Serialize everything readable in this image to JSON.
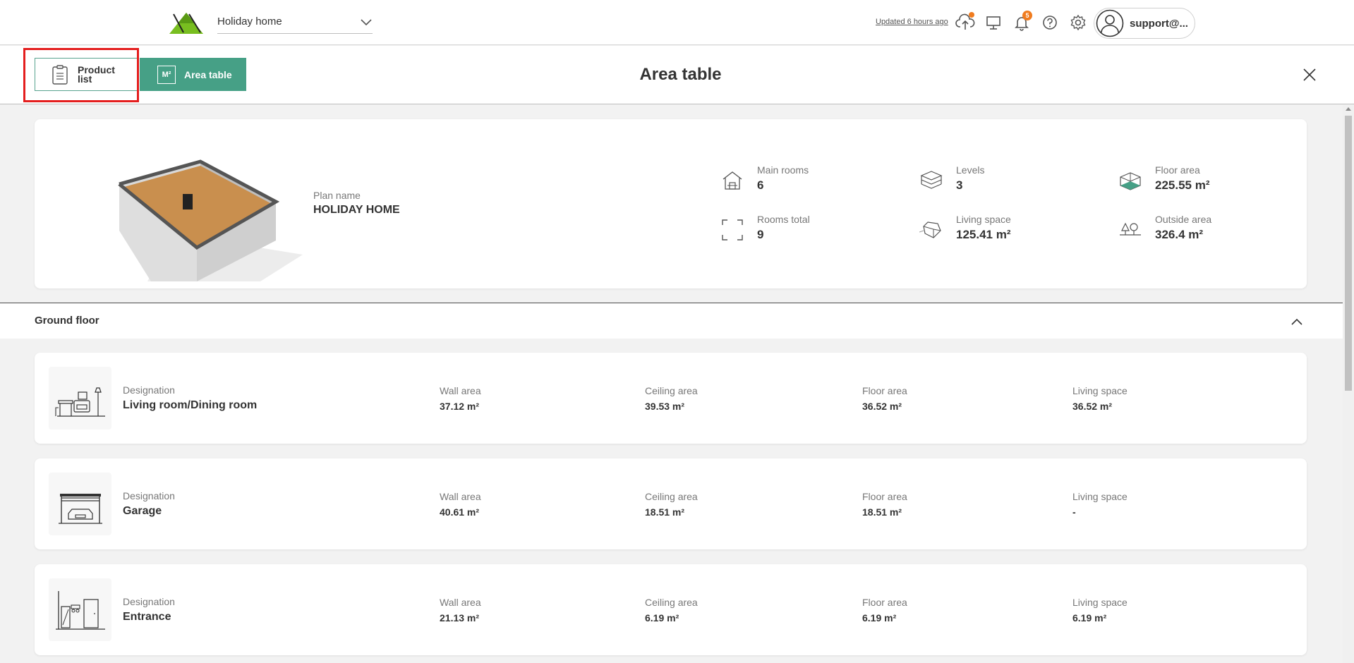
{
  "header": {
    "project_name": "Holiday home",
    "updated_text": "Updated 6 hours ago",
    "notification_count": "5",
    "user_name": "support@...",
    "colors": {
      "accent": "#46a086",
      "badge": "#f07c1f",
      "logo_green": "#78be20"
    }
  },
  "icons": {
    "cloud": "cloud-upload-icon",
    "presentation": "presentation-icon",
    "bell": "bell-icon",
    "help": "help-icon",
    "settings": "gear-icon",
    "user": "user-avatar-icon"
  },
  "tabs": {
    "product_list": "Product list",
    "area_table_icon": "M²",
    "area_table": "Area table"
  },
  "page": {
    "title": "Area table"
  },
  "summary": {
    "plan_name_label": "Plan name",
    "plan_name": "HOLIDAY HOME",
    "stats": {
      "main_rooms": {
        "label": "Main rooms",
        "value": "6"
      },
      "rooms_total": {
        "label": "Rooms total",
        "value": "9"
      },
      "levels": {
        "label": "Levels",
        "value": "3"
      },
      "living_space": {
        "label": "Living space",
        "value": "125.41 m²"
      },
      "floor_area": {
        "label": "Floor area",
        "value": "225.55 m²"
      },
      "outside_area": {
        "label": "Outside area",
        "value": "326.4 m²"
      }
    }
  },
  "section": {
    "title": "Ground floor"
  },
  "room_headers": {
    "designation": "Designation",
    "wall_area": "Wall area",
    "ceiling_area": "Ceiling area",
    "floor_area": "Floor area",
    "living_space": "Living space"
  },
  "rooms": [
    {
      "name": "Living room/Dining room",
      "wall_area": "37.12 m²",
      "ceiling_area": "39.53 m²",
      "floor_area": "36.52 m²",
      "living_space": "36.52 m²"
    },
    {
      "name": "Garage",
      "wall_area": "40.61 m²",
      "ceiling_area": "18.51 m²",
      "floor_area": "18.51 m²",
      "living_space": "-"
    },
    {
      "name": "Entrance",
      "wall_area": "21.13 m²",
      "ceiling_area": "6.19 m²",
      "floor_area": "6.19 m²",
      "living_space": "6.19 m²"
    }
  ]
}
